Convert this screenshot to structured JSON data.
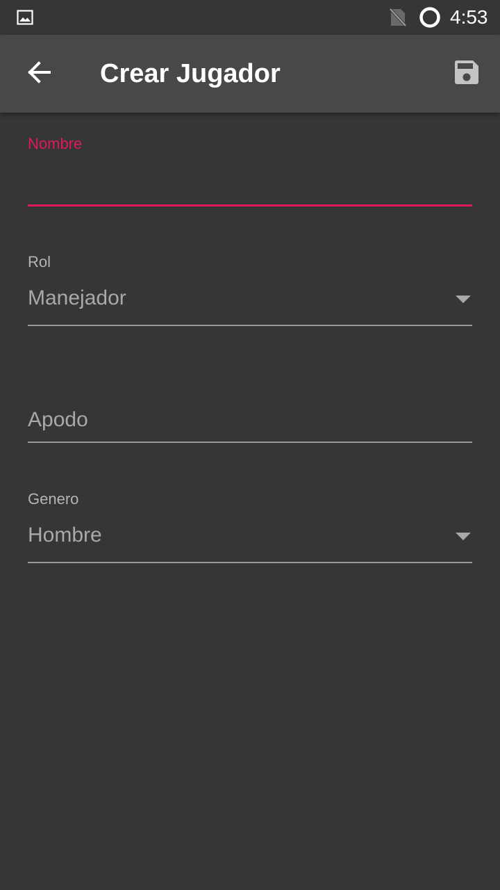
{
  "status_bar": {
    "time": "4:53",
    "icons": [
      "gallery-icon",
      "no-sim-icon",
      "sync-icon"
    ]
  },
  "app_bar": {
    "title": "Crear Jugador",
    "back_icon": "arrow-back-icon",
    "save_icon": "save-icon"
  },
  "form": {
    "nombre": {
      "label": "Nombre",
      "value": ""
    },
    "rol": {
      "label": "Rol",
      "selected": "Manejador"
    },
    "apodo": {
      "placeholder": "Apodo",
      "value": ""
    },
    "genero": {
      "label": "Genero",
      "selected": "Hombre"
    }
  },
  "colors": {
    "accent": "#e0185c",
    "background": "#363636",
    "app_bar": "#484848",
    "text_secondary": "#a9a9a9",
    "divider": "#9a9a9a"
  }
}
